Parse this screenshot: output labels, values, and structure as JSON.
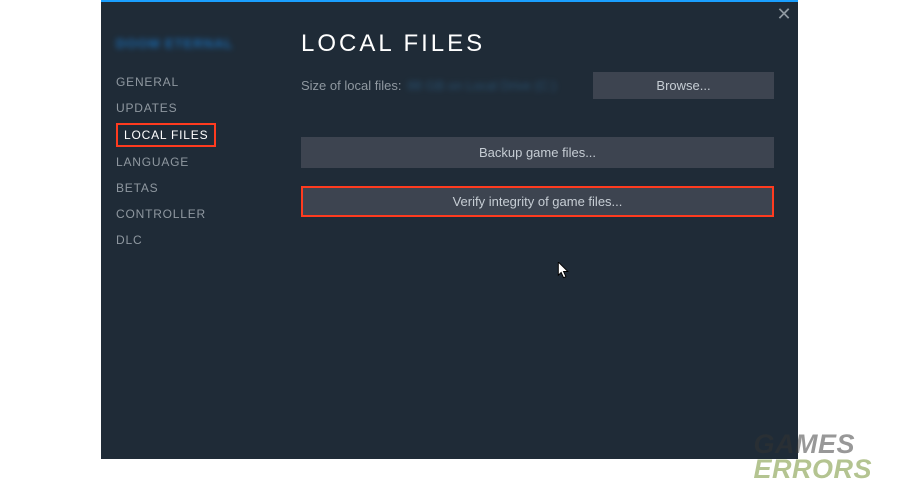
{
  "game_title_obscured": "DOOM ETERNAL",
  "sidebar": {
    "items": [
      {
        "label": "GENERAL"
      },
      {
        "label": "UPDATES"
      },
      {
        "label": "LOCAL FILES"
      },
      {
        "label": "LANGUAGE"
      },
      {
        "label": "BETAS"
      },
      {
        "label": "CONTROLLER"
      },
      {
        "label": "DLC"
      }
    ]
  },
  "header": {
    "title": "LOCAL FILES"
  },
  "local_files": {
    "size_label": "Size of local files:",
    "size_value_obscured": "88 GB on Local Drive (C:)",
    "browse_label": "Browse...",
    "backup_label": "Backup game files...",
    "verify_label": "Verify integrity of game files..."
  },
  "watermark": {
    "line1": "GAMES",
    "line2": "ERRORS"
  }
}
